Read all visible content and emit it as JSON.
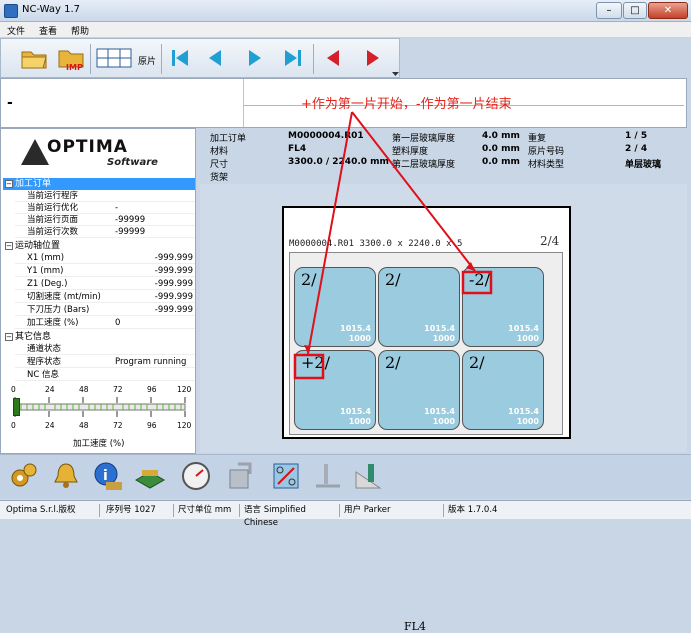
{
  "window": {
    "title": "NC-Way 1.7",
    "minimize": "–",
    "maximize": "□",
    "close": "✕"
  },
  "menu": [
    "文件",
    "查看",
    "帮助"
  ],
  "toolbar": {
    "label_pian": "原片"
  },
  "message": {
    "left_value": "-",
    "hint": "+作为第一片开始，-作为第一片结束"
  },
  "logo": {
    "brand": "OPTIMA",
    "sub": "Software"
  },
  "tree": {
    "section1": {
      "title": "加工订单",
      "rows": [
        {
          "k": "当前运行程序",
          "v": ""
        },
        {
          "k": "当前运行优化",
          "v": "-"
        },
        {
          "k": "当前运行页面",
          "v": "-99999"
        },
        {
          "k": "当前运行次数",
          "v": "-99999"
        }
      ]
    },
    "section2": {
      "title": "运动轴位置",
      "rows": [
        {
          "k": "X1 (mm)",
          "v": "-999.999"
        },
        {
          "k": "Y1 (mm)",
          "v": "-999.999"
        },
        {
          "k": "Z1 (Deg.)",
          "v": "-999.999"
        },
        {
          "k": "切割速度 (mt/min)",
          "v": "-999.999"
        },
        {
          "k": "下刀压力 (Bars)",
          "v": "-999.999"
        },
        {
          "k": "加工速度 (%)",
          "v": "0"
        }
      ]
    },
    "section3": {
      "title": "其它信息",
      "rows": [
        {
          "k": "通道状态",
          "v": ""
        },
        {
          "k": "程序状态",
          "v": "Program running"
        },
        {
          "k": "NC 信息",
          "v": ""
        }
      ]
    }
  },
  "gauge": {
    "ticks": [
      "0",
      "24",
      "48",
      "72",
      "96",
      "120"
    ],
    "label": "加工速度 (%)",
    "value": 0
  },
  "info": {
    "col1": [
      {
        "k": "加工订单",
        "v": "M0000004.R01"
      },
      {
        "k": "材料",
        "v": "FL4"
      },
      {
        "k": "尺寸",
        "v": "3300.0 / 2240.0 mm"
      },
      {
        "k": "货架",
        "v": ""
      }
    ],
    "col2": [
      {
        "k": "第一层玻璃厚度",
        "v": "4.0 mm"
      },
      {
        "k": "塑料厚度",
        "v": "0.0 mm"
      },
      {
        "k": "第二层玻璃厚度",
        "v": "0.0 mm"
      }
    ],
    "col3": [
      {
        "k": "重复",
        "v": "1 / 5"
      },
      {
        "k": "原片号码",
        "v": "2 / 4"
      },
      {
        "k": "材料类型",
        "v": "单层玻璃"
      }
    ]
  },
  "drawing": {
    "title": "M0000004.R01     3300.0 x 2240.0 x 5",
    "count": "2/4",
    "material": "FL4",
    "panes": [
      {
        "n": "2/",
        "d1": "1015.4",
        "d2": "1000"
      },
      {
        "n": "2/",
        "d1": "1015.4",
        "d2": "1000"
      },
      {
        "n": "-2/",
        "d1": "1015.4",
        "d2": "1000"
      },
      {
        "n": "+2/",
        "d1": "1015.4",
        "d2": "1000"
      },
      {
        "n": "2/",
        "d1": "1015.4",
        "d2": "1000"
      },
      {
        "n": "2/",
        "d1": "1015.4",
        "d2": "1000"
      }
    ]
  },
  "status": [
    "Optima S.r.l.版权",
    "序列号 1027",
    "尺寸单位 mm",
    "语言 Simplified Chinese",
    "用户 Parker",
    "版本 1.7.0.4"
  ]
}
